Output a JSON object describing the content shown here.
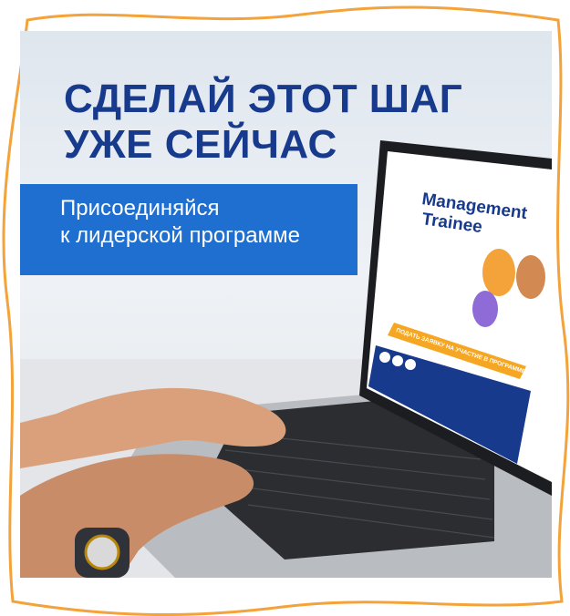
{
  "headline": {
    "line1": "СДЕЛАЙ ЭТОТ ШАГ",
    "line2": "УЖЕ СЕЙЧАС"
  },
  "banner": {
    "line1": "Присоединяйся",
    "line2": "к лидерской программе"
  },
  "laptop_screen": {
    "title_line1": "Management",
    "title_line2": "Trainee",
    "apply_label": "ПОДАТЬ ЗАЯВКУ НА УЧАСТИЕ В ПРОГРАММЕ"
  },
  "colors": {
    "brand_blue": "#173a8c",
    "banner_blue": "#1f6fd0",
    "frame_orange": "#f3a33a",
    "accent_orange": "#f5a623"
  }
}
